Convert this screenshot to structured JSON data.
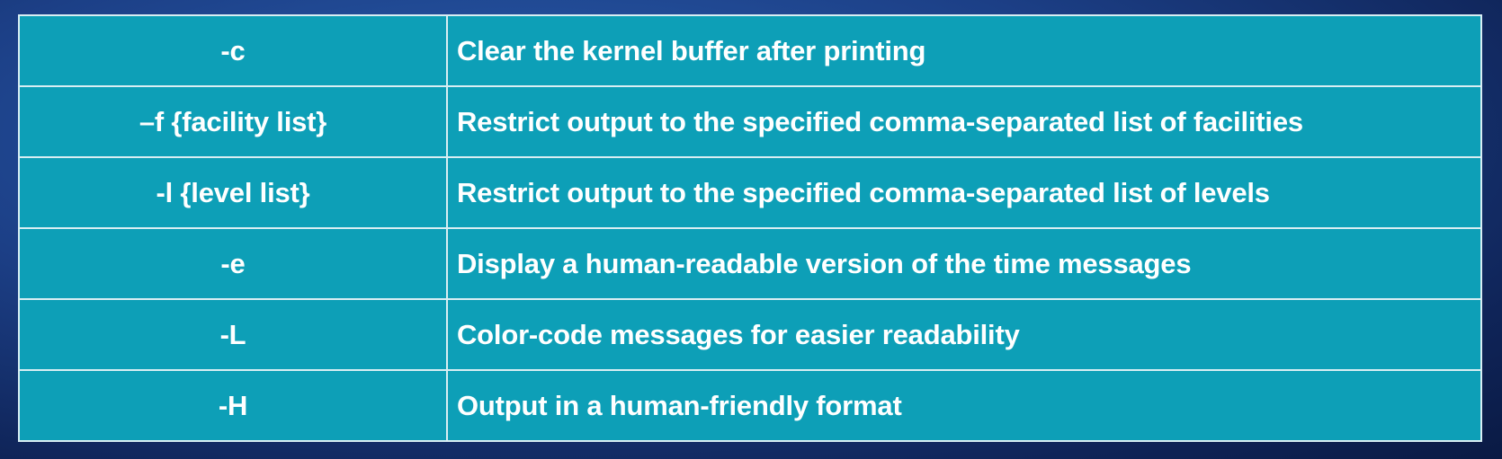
{
  "table": {
    "rows": [
      {
        "option": "-c",
        "description": "Clear the kernel buffer after printing"
      },
      {
        "option": "–f {facility list}",
        "description": "Restrict output to the specified comma-separated list of facilities"
      },
      {
        "option": "-l {level list}",
        "description": "Restrict output to the specified comma-separated list of levels"
      },
      {
        "option": "-e",
        "description": "Display a human-readable version of the time messages"
      },
      {
        "option": "-L",
        "description": "Color-code messages for easier readability"
      },
      {
        "option": "-H",
        "description": "Output in a human-friendly format"
      }
    ]
  },
  "colors": {
    "table_fill": "#0d9fb7",
    "table_border": "#d8eef3",
    "text": "#ffffff",
    "background": "#1c3f86"
  }
}
